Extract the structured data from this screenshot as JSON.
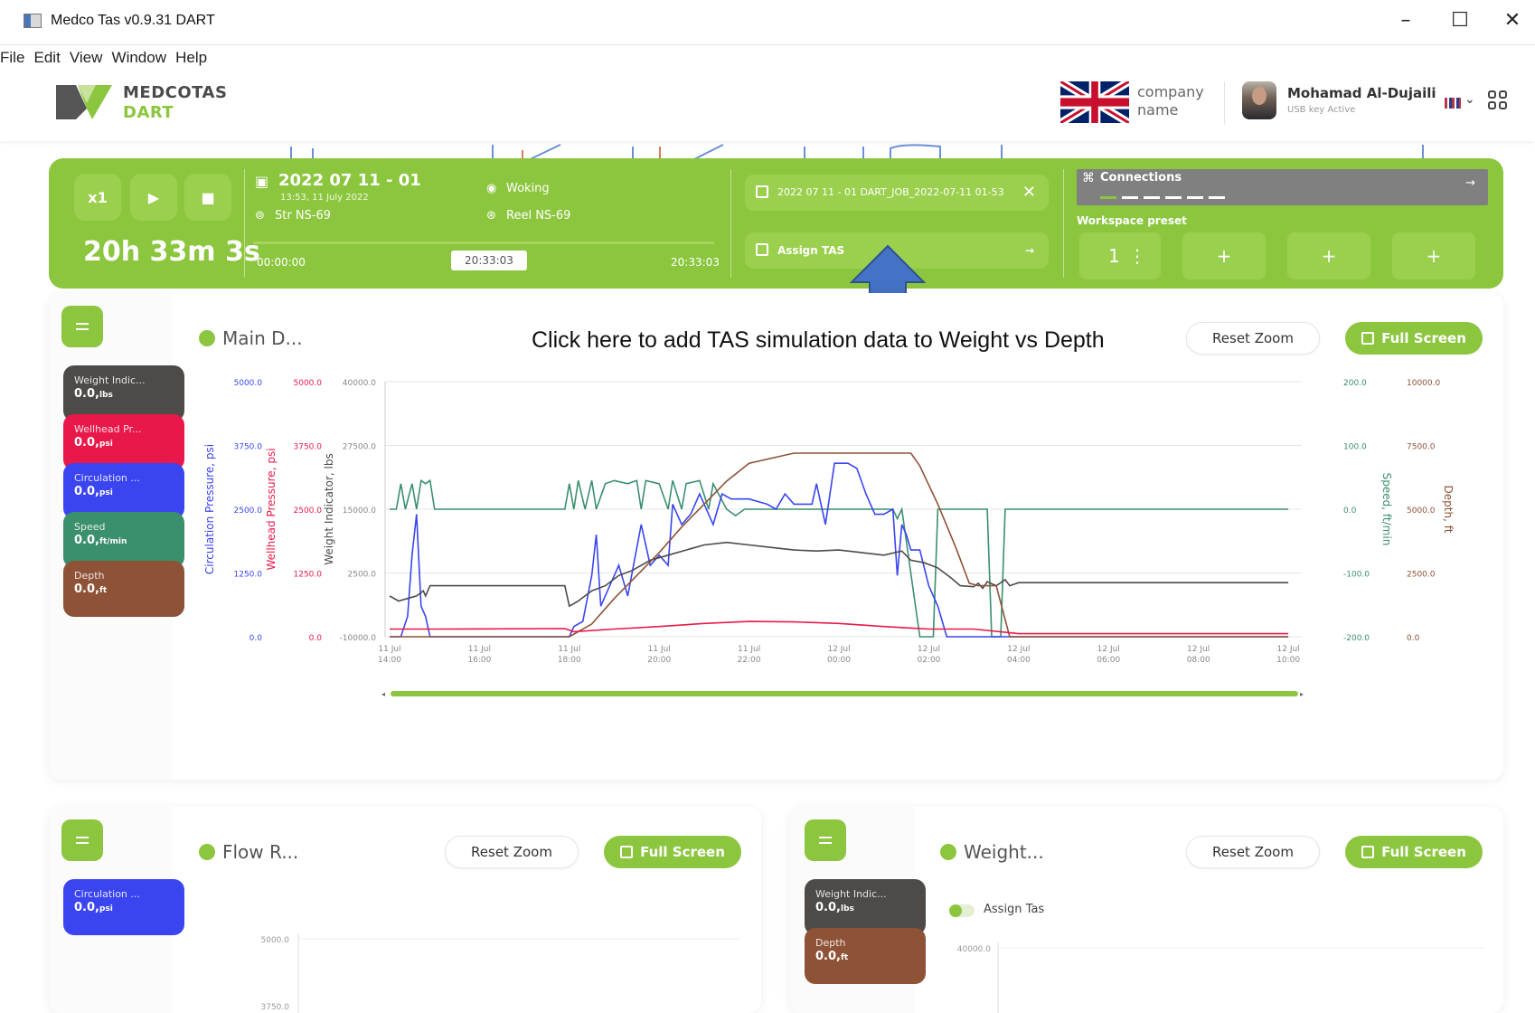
{
  "window": {
    "title": "Medco Tas v0.9.31  DART",
    "minimize": "–",
    "maximize": "☐",
    "close": "✕"
  },
  "menu": [
    "File",
    "Edit",
    "View",
    "Window",
    "Help"
  ],
  "brand": {
    "line1": "MEDCOTAS",
    "line2": "DART"
  },
  "header": {
    "company_line1": "company",
    "company_line2": "name",
    "user_name": "Mohamad Al-Dujaili",
    "usb_status": "USB key Active",
    "chevron": "⌄"
  },
  "toolbar": {
    "speed_label": "x1",
    "play_icon": "▶",
    "stop_icon": "■",
    "timer": "20h 33m 3s",
    "job_date": "2022 07 11 - 01",
    "job_time": "13:53, 11 July 2022",
    "location": "Woking",
    "string": "Str NS-69",
    "reel": "Reel NS-69",
    "time_start": "00:00:00",
    "time_current": "20:33:03",
    "time_end": "20:33:03",
    "job_file": "2022 07 11 - 01 DART_JOB_2022-07-11 01-53",
    "job_close": "✕",
    "assign_tas": "Assign TAS",
    "arrow": "→",
    "connections": "Connections",
    "workspace_label": "Workspace preset",
    "preset_number": "1",
    "preset_menu": "⋮",
    "preset_add": "+"
  },
  "annotation": "Click here to add TAS simulation data to Weight vs Depth",
  "colors": {
    "accent": "#8cc63f",
    "weight": "#4d4a47",
    "wellhead": "#e8194a",
    "circulation": "#3a45f0",
    "speed": "#3a8f6d",
    "depth": "#8e5237",
    "annotation_arrow": "#4472c4"
  },
  "main_card": {
    "title": "Main D...",
    "reset_zoom": "Reset Zoom",
    "full_screen": "Full Screen",
    "chips": [
      {
        "name": "Weight Indic...",
        "value": "0.0",
        "unit": "lbs"
      },
      {
        "name": "Wellhead Pr...",
        "value": "0.0",
        "unit": "psi"
      },
      {
        "name": "Circulation ...",
        "value": "0.0",
        "unit": "psi"
      },
      {
        "name": "Speed",
        "value": "0.0",
        "unit": "ft/min"
      },
      {
        "name": "Depth",
        "value": "0.0",
        "unit": "ft"
      }
    ]
  },
  "chart_data": {
    "type": "line",
    "x_ticks": [
      [
        "11 Jul",
        "14:00"
      ],
      [
        "11 Jul",
        "16:00"
      ],
      [
        "11 Jul",
        "18:00"
      ],
      [
        "11 Jul",
        "20:00"
      ],
      [
        "11 Jul",
        "22:00"
      ],
      [
        "12 Jul",
        "00:00"
      ],
      [
        "12 Jul",
        "02:00"
      ],
      [
        "12 Jul",
        "04:00"
      ],
      [
        "12 Jul",
        "06:00"
      ],
      [
        "12 Jul",
        "08:00"
      ],
      [
        "12 Jul",
        "10:00"
      ]
    ],
    "x_hours": [
      0,
      2,
      4,
      6,
      8,
      10,
      12,
      14,
      16,
      18,
      20
    ],
    "xlim_hours": [
      -0.1,
      20.3
    ],
    "axes": [
      {
        "label": "Circulation Pressure, psi",
        "ticks": [
          "5000.0",
          "3750.0",
          "2500.0",
          "1250.0",
          "0.0"
        ],
        "range": [
          0,
          5000
        ]
      },
      {
        "label": "Wellhead Pressure, psi",
        "ticks": [
          "5000.0",
          "3750.0",
          "2500.0",
          "1250.0",
          "0.0"
        ],
        "range": [
          0,
          5000
        ]
      },
      {
        "label": "Weight Indicator, lbs",
        "ticks": [
          "40000.0",
          "27500.0",
          "15000.0",
          "2500.0",
          "-10000.0"
        ],
        "range": [
          -10000,
          40000
        ]
      },
      {
        "label": "Speed, ft/min",
        "ticks": [
          "200.0",
          "100.0",
          "0.0",
          "-100.0",
          "-200.0"
        ],
        "range": [
          -200,
          200
        ]
      },
      {
        "label": "Depth, ft",
        "ticks": [
          "10000.0",
          "7500.0",
          "5000.0",
          "2500.0",
          "0.0"
        ],
        "range": [
          0,
          10000
        ]
      }
    ],
    "series": [
      {
        "name": "Speed",
        "axis": 3,
        "points": [
          [
            0,
            0
          ],
          [
            0.15,
            0
          ],
          [
            0.25,
            40
          ],
          [
            0.35,
            0
          ],
          [
            0.5,
            40
          ],
          [
            0.6,
            0
          ],
          [
            0.7,
            45
          ],
          [
            0.8,
            40
          ],
          [
            0.9,
            45
          ],
          [
            1.0,
            0
          ],
          [
            3.9,
            0
          ],
          [
            4.0,
            40
          ],
          [
            4.1,
            0
          ],
          [
            4.2,
            45
          ],
          [
            4.35,
            0
          ],
          [
            4.5,
            45
          ],
          [
            4.6,
            0
          ],
          [
            4.8,
            40
          ],
          [
            5.0,
            45
          ],
          [
            5.3,
            40
          ],
          [
            5.5,
            45
          ],
          [
            5.6,
            0
          ],
          [
            5.7,
            45
          ],
          [
            6.0,
            40
          ],
          [
            6.2,
            0
          ],
          [
            6.3,
            45
          ],
          [
            6.5,
            0
          ],
          [
            6.6,
            40
          ],
          [
            6.9,
            45
          ],
          [
            7.1,
            0
          ],
          [
            7.2,
            40
          ],
          [
            7.5,
            0
          ],
          [
            7.7,
            -10
          ],
          [
            7.9,
            0
          ],
          [
            11.2,
            0
          ],
          [
            11.3,
            -15
          ],
          [
            11.4,
            0
          ],
          [
            11.7,
            -150
          ],
          [
            11.8,
            -200
          ],
          [
            12.1,
            -200
          ],
          [
            12.2,
            0
          ],
          [
            13.3,
            0
          ],
          [
            13.4,
            -200
          ],
          [
            13.6,
            -200
          ],
          [
            13.7,
            0
          ],
          [
            20.0,
            0
          ]
        ]
      },
      {
        "name": "Circulation Pressure",
        "axis": 0,
        "points": [
          [
            0,
            0
          ],
          [
            0.25,
            0
          ],
          [
            0.4,
            400
          ],
          [
            0.5,
            1600
          ],
          [
            0.6,
            2400
          ],
          [
            0.7,
            600
          ],
          [
            0.8,
            400
          ],
          [
            0.9,
            0
          ],
          [
            4.0,
            0
          ],
          [
            4.1,
            200
          ],
          [
            4.3,
            300
          ],
          [
            4.5,
            1200
          ],
          [
            4.6,
            2000
          ],
          [
            4.7,
            600
          ],
          [
            4.9,
            1000
          ],
          [
            5.1,
            1400
          ],
          [
            5.3,
            800
          ],
          [
            5.6,
            2200
          ],
          [
            5.8,
            1400
          ],
          [
            6.0,
            1600
          ],
          [
            6.2,
            1400
          ],
          [
            6.3,
            2600
          ],
          [
            6.5,
            2200
          ],
          [
            6.7,
            2400
          ],
          [
            6.9,
            2800
          ],
          [
            7.2,
            2200
          ],
          [
            7.4,
            2800
          ],
          [
            7.6,
            2700
          ],
          [
            8.0,
            2700
          ],
          [
            8.4,
            2600
          ],
          [
            8.6,
            2500
          ],
          [
            8.8,
            2800
          ],
          [
            9.0,
            2600
          ],
          [
            9.4,
            2600
          ],
          [
            9.5,
            3000
          ],
          [
            9.7,
            2200
          ],
          [
            9.9,
            3400
          ],
          [
            10.2,
            3400
          ],
          [
            10.4,
            3300
          ],
          [
            10.6,
            2800
          ],
          [
            10.8,
            2400
          ],
          [
            11.0,
            2400
          ],
          [
            11.2,
            2500
          ],
          [
            11.3,
            1200
          ],
          [
            11.4,
            2200
          ],
          [
            11.5,
            2000
          ],
          [
            11.6,
            1700
          ],
          [
            11.8,
            1700
          ],
          [
            12.0,
            1000
          ],
          [
            12.2,
            600
          ],
          [
            12.4,
            0
          ],
          [
            20.0,
            0
          ]
        ]
      },
      {
        "name": "Weight Indicator",
        "axis": 2,
        "points": [
          [
            0,
            -2000
          ],
          [
            0.2,
            -3000
          ],
          [
            0.4,
            -2500
          ],
          [
            0.6,
            -2000
          ],
          [
            0.75,
            -1000
          ],
          [
            0.8,
            -2000
          ],
          [
            0.9,
            0
          ],
          [
            1.2,
            0
          ],
          [
            3.9,
            0
          ],
          [
            4.0,
            -4000
          ],
          [
            4.2,
            -3000
          ],
          [
            4.5,
            -1000
          ],
          [
            4.8,
            0
          ],
          [
            5.1,
            2000
          ],
          [
            5.4,
            3000
          ],
          [
            5.8,
            5000
          ],
          [
            6.2,
            6000
          ],
          [
            6.6,
            7000
          ],
          [
            7.0,
            8000
          ],
          [
            7.5,
            8500
          ],
          [
            8.0,
            8000
          ],
          [
            8.5,
            7500
          ],
          [
            9.0,
            7000
          ],
          [
            9.5,
            6800
          ],
          [
            10.0,
            7000
          ],
          [
            10.5,
            6500
          ],
          [
            11.0,
            6000
          ],
          [
            11.4,
            6800
          ],
          [
            11.6,
            5000
          ],
          [
            11.9,
            4500
          ],
          [
            12.2,
            3500
          ],
          [
            12.5,
            1500
          ],
          [
            12.7,
            0
          ],
          [
            13.0,
            -200
          ],
          [
            13.1,
            500
          ],
          [
            13.2,
            -500
          ],
          [
            13.3,
            800
          ],
          [
            13.5,
            0
          ],
          [
            13.7,
            1200
          ],
          [
            13.8,
            0
          ],
          [
            14.0,
            600
          ],
          [
            20.0,
            600
          ]
        ]
      },
      {
        "name": "Depth",
        "axis": 4,
        "points": [
          [
            0,
            0
          ],
          [
            4.0,
            0
          ],
          [
            4.5,
            500
          ],
          [
            5.0,
            1500
          ],
          [
            5.5,
            2400
          ],
          [
            6.0,
            3300
          ],
          [
            6.5,
            4300
          ],
          [
            7.0,
            5200
          ],
          [
            7.5,
            6100
          ],
          [
            8.0,
            6800
          ],
          [
            9.0,
            7200
          ],
          [
            10.5,
            7200
          ],
          [
            11.6,
            7200
          ],
          [
            11.8,
            6700
          ],
          [
            12.2,
            5200
          ],
          [
            12.6,
            3500
          ],
          [
            12.9,
            2100
          ],
          [
            13.1,
            2000
          ],
          [
            13.5,
            2000
          ],
          [
            13.8,
            0
          ],
          [
            20.0,
            0
          ]
        ]
      },
      {
        "name": "Wellhead Pressure",
        "axis": 1,
        "points": [
          [
            0,
            150
          ],
          [
            1.0,
            150
          ],
          [
            3.9,
            160
          ],
          [
            4.1,
            100
          ],
          [
            5.0,
            150
          ],
          [
            6.0,
            200
          ],
          [
            7.0,
            260
          ],
          [
            8.0,
            300
          ],
          [
            9.0,
            290
          ],
          [
            10.0,
            260
          ],
          [
            11.0,
            200
          ],
          [
            12.0,
            150
          ],
          [
            13.0,
            150
          ],
          [
            14.0,
            60
          ],
          [
            20.0,
            60
          ]
        ]
      }
    ]
  },
  "flow_card": {
    "title": "Flow R...",
    "reset_zoom": "Reset Zoom",
    "full_screen": "Full Screen",
    "chip": {
      "name": "Circulation ...",
      "value": "0.0",
      "unit": "psi"
    },
    "y_ticks": [
      "5000.0",
      "3750.0"
    ]
  },
  "weight_card": {
    "title": "Weight...",
    "reset_zoom": "Reset Zoom",
    "full_screen": "Full Screen",
    "toggle_label": "Assign Tas",
    "chips": [
      {
        "name": "Weight Indic...",
        "value": "0.0",
        "unit": "lbs"
      },
      {
        "name": "Depth",
        "value": "0.0",
        "unit": "ft"
      }
    ],
    "y_ticks": [
      "40000.0"
    ]
  }
}
